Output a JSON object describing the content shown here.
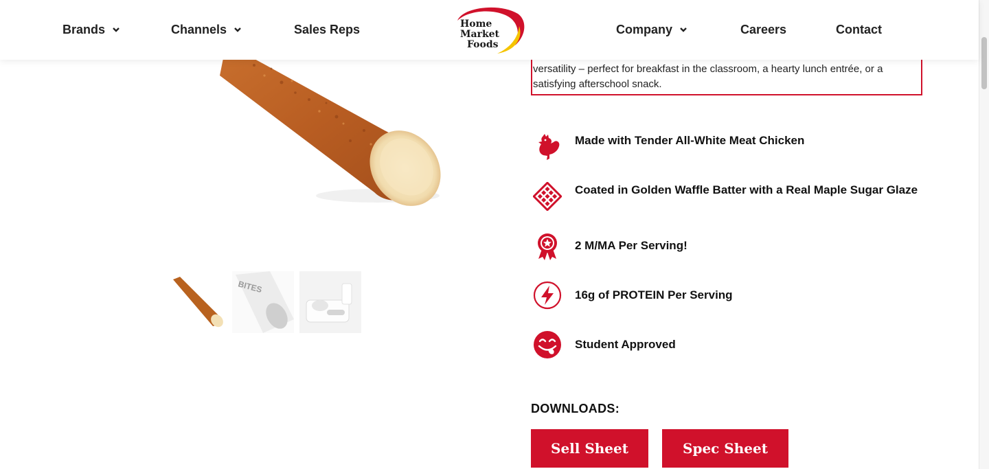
{
  "header": {
    "nav_left": [
      {
        "label": "Brands",
        "has_dropdown": true
      },
      {
        "label": "Channels",
        "has_dropdown": true
      },
      {
        "label": "Sales Reps",
        "has_dropdown": false
      }
    ],
    "nav_right": [
      {
        "label": "Company",
        "has_dropdown": true
      },
      {
        "label": "Careers",
        "has_dropdown": false
      },
      {
        "label": "Contact",
        "has_dropdown": false
      }
    ],
    "logo": {
      "line1": "Home",
      "line2": "Market",
      "line3": "Foods"
    }
  },
  "description": {
    "text": "versatility – perfect for breakfast in the classroom, a hearty lunch entrée, or a satisfying afterschool snack."
  },
  "features": [
    {
      "icon": "chicken-icon",
      "text": "Made with Tender All-White Meat Chicken"
    },
    {
      "icon": "waffle-icon",
      "text": "Coated in Golden Waffle Batter with a Real Maple Sugar Glaze"
    },
    {
      "icon": "award-ribbon-icon",
      "text": "2 M/MA Per Serving!"
    },
    {
      "icon": "lightning-bolt-icon",
      "text": "16g of PROTEIN Per Serving"
    },
    {
      "icon": "smiley-tongue-icon",
      "text": "Student Approved"
    }
  ],
  "thumbnail_bag_text": "BITES",
  "downloads": {
    "heading": "DOWNLOADS:",
    "sell_sheet": "Sell Sheet",
    "spec_sheet": "Spec Sheet"
  },
  "colors": {
    "brand_red": "#d0112b",
    "logo_yellow": "#f5c400",
    "text_dark": "#111111"
  }
}
